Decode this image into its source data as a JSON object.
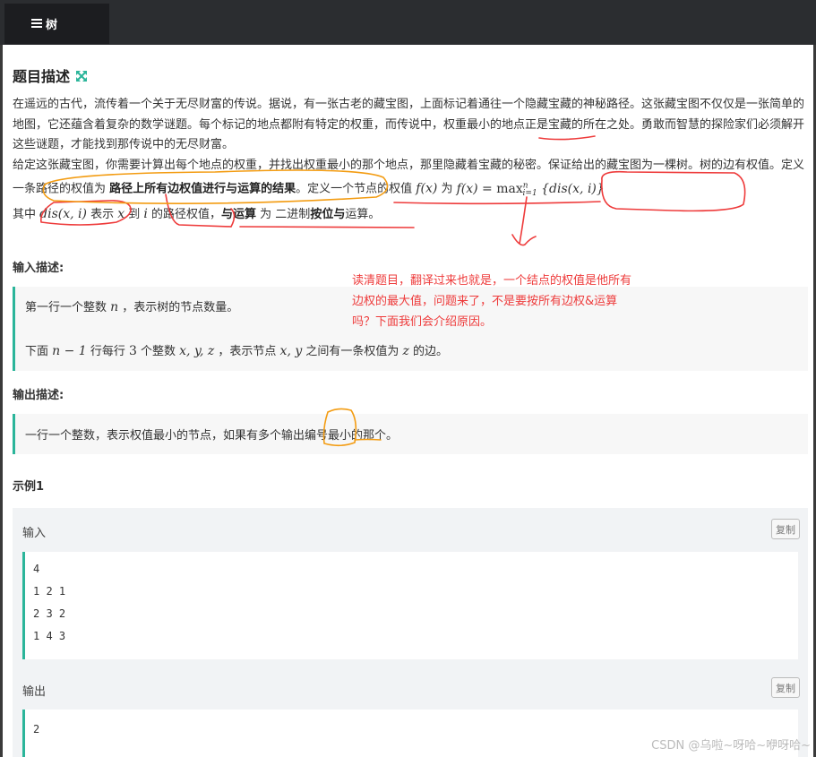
{
  "tab": {
    "label": "树"
  },
  "problem": {
    "title": "题目描述",
    "p1": "在遥远的古代，流传着一个关于无尽财富的传说。据说，有一张古老的藏宝图，上面标记着通往一个隐藏宝藏的神秘路径。这张藏宝图不仅仅是一张简单的地图，它还蕴含着复杂的数学谜题。每个标记的地点都附有特定的权重，而传说中，权重最小的地点正是宝藏的所在之处。勇敢而智慧的探险家们必须解开这些谜题，才能找到那传说中的无尽财富。",
    "p2_a": "给定这张藏宝图，你需要计算出每个地点的权重，并找出权重最小的那个地点，那里隐藏着宝藏的秘密。保证给出的藏宝图为一棵树。树的边有权值。定义一条路径的权值为 ",
    "p2_b": "路径上所有边权值进行与运算的结果",
    "p2_c": "。定义一个节点的权值 ",
    "p2_fx": "f(x)",
    "p2_d": " 为 ",
    "p2_formula_lhs": "f(x) = ",
    "p2_max": "max",
    "p2_sup": "n",
    "p2_sub": "i=1",
    "p2_formula_rhs": " {dis(x, i)}",
    "p3_a": "其中 ",
    "p3_dis": "dis(x, i)",
    "p3_b": " 表示 ",
    "p3_x": "x",
    "p3_c": " 到 ",
    "p3_i": "i",
    "p3_d": " 的路径权值，",
    "p3_e": "与运算",
    "p3_f": " 为 二进制",
    "p3_g": "按位与",
    "p3_h": "运算。"
  },
  "input": {
    "title": "输入描述:",
    "line1_a": "第一行一个整数 ",
    "line1_n": "n",
    "line1_b": " ，表示树的节点数量。",
    "line2_a": "下面 ",
    "line2_n1": "n − 1",
    "line2_b": " 行每行 ",
    "line2_3": "3",
    "line2_c": " 个整数 ",
    "line2_xyz": "x, y, z",
    "line2_d": " ，表示节点 ",
    "line2_xy": "x, y",
    "line2_e": " 之间有一条权值为 ",
    "line2_z": "z",
    "line2_f": " 的边。"
  },
  "output": {
    "title": "输出描述:",
    "line": "一行一个整数，表示权值最小的节点，如果有多个输出编号最小的那个。"
  },
  "example": {
    "title": "示例1",
    "input_label": "输入",
    "output_label": "输出",
    "copy_label": "复制",
    "input_lines": [
      "4",
      "1 2 1",
      "2 3 2",
      "1 4 3"
    ],
    "output_lines": [
      "2"
    ]
  },
  "annotation": {
    "line1": "读清题目，翻译过来也就是，一个结点的权值是他所有",
    "line2": "边权的最大值，问题来了，不是要按所有边权&运算",
    "line3": "吗？下面我们会介绍原因。"
  },
  "watermark": "CSDN @乌啦~呀哈~咿呀哈~",
  "colors": {
    "accent": "#2bb59a",
    "annotation_red": "#ee3b3b",
    "annotation_orange": "#f39c12",
    "topbar": "#2b2d30"
  }
}
